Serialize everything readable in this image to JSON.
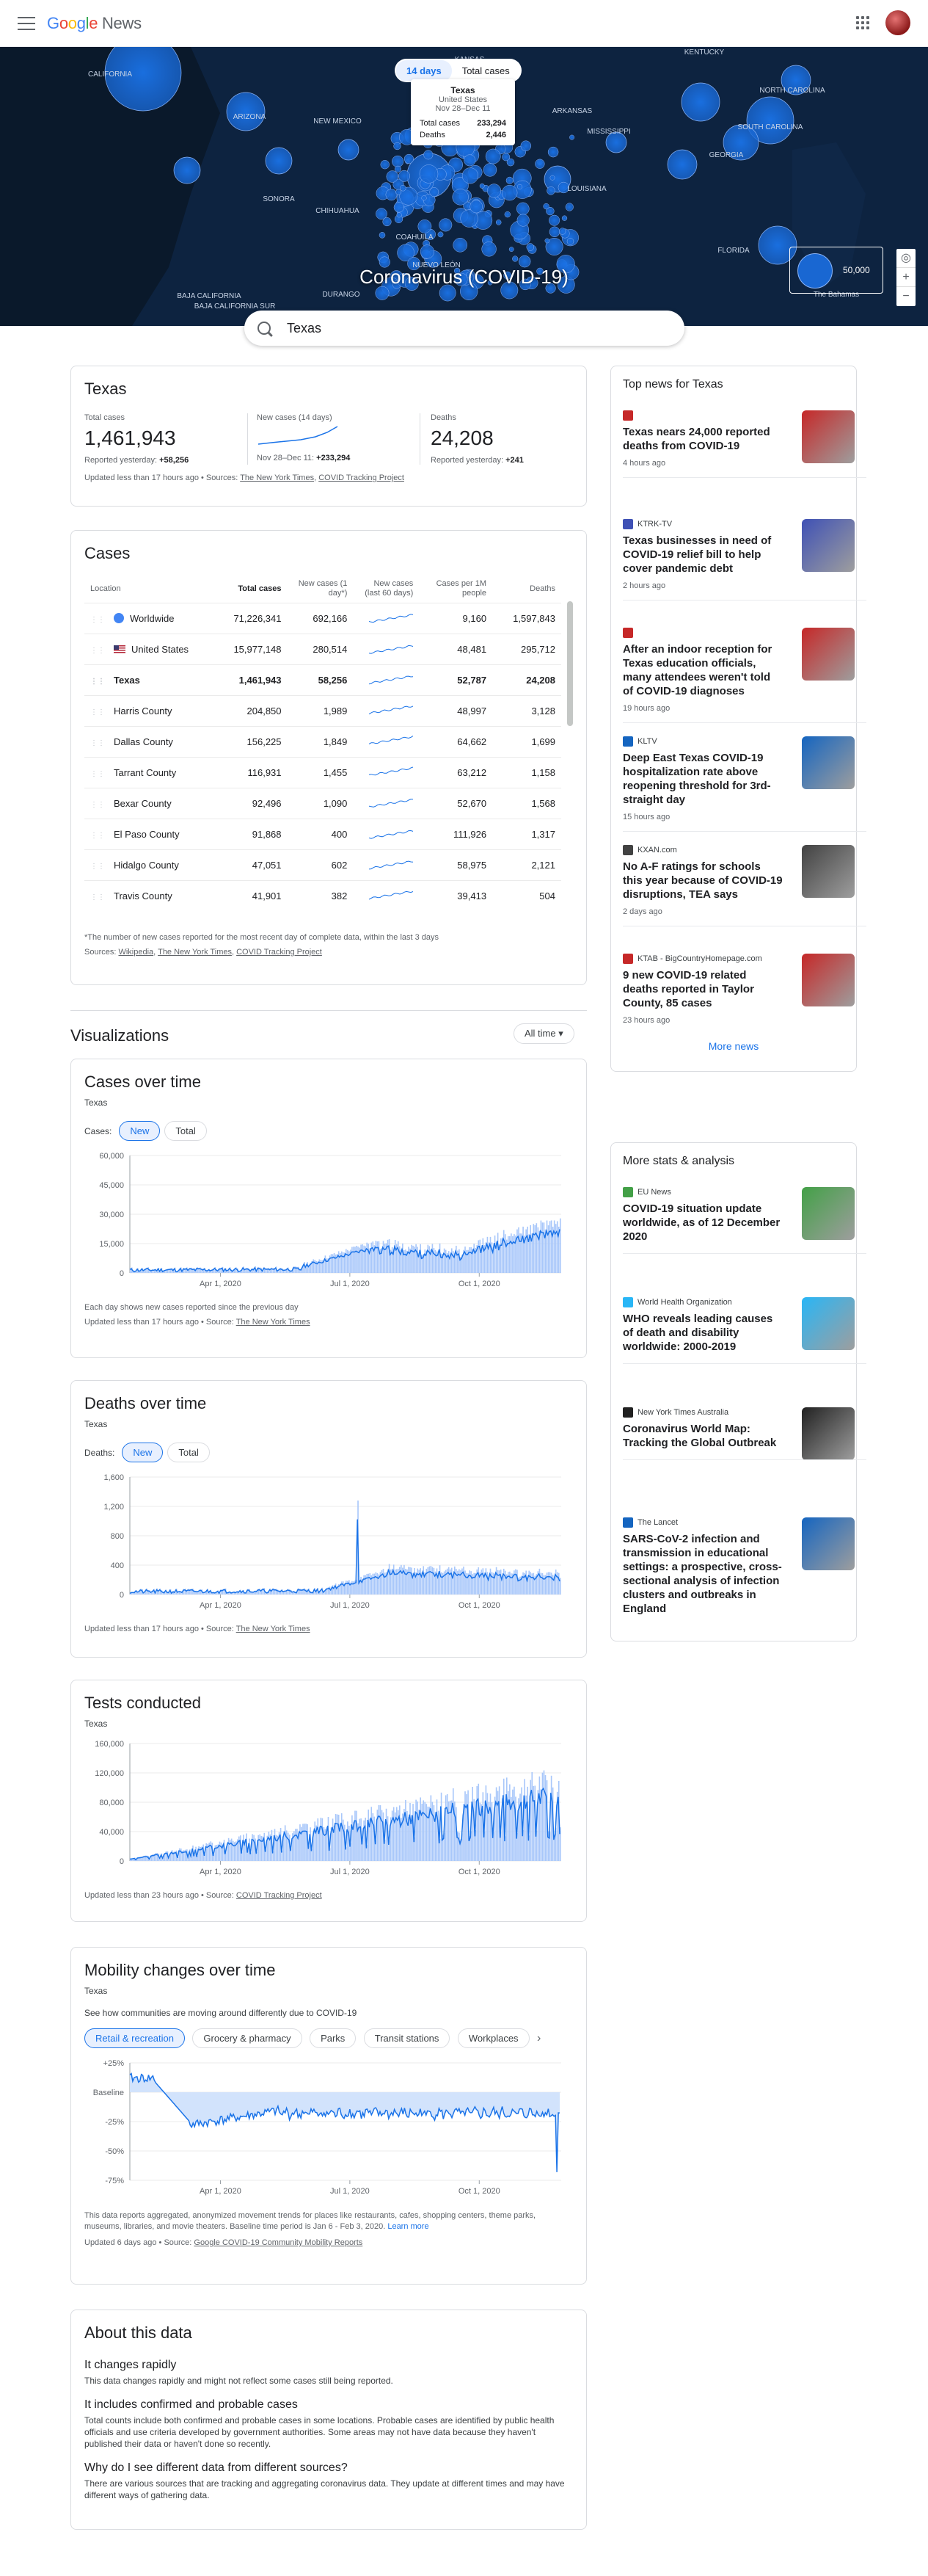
{
  "header": {
    "logo_google": "Google",
    "logo_news": "News"
  },
  "map": {
    "title": "Coronavirus (COVID-19)",
    "toggle": [
      "14 days",
      "Total cases"
    ],
    "tooltip": {
      "name": "Texas",
      "country": "United States",
      "range": "Nov 28–Dec 11",
      "cases_label": "Total cases",
      "cases": "233,294",
      "deaths_label": "Deaths",
      "deaths": "2,446"
    },
    "legend_value": "50,000",
    "labels": [
      "CALIFORNIA",
      "ARIZONA",
      "NEW MEXICO",
      "SONORA",
      "CHIHUAHUA",
      "BAJA CALIFORNIA",
      "COAHUILA",
      "KANSAS",
      "ARKANSAS",
      "MISSISSIPPI",
      "GEORGIA",
      "SOUTH CAROLINA",
      "NORTH CAROLINA",
      "LOUISIANA",
      "FLORIDA",
      "KENTUCKY",
      "NUEVO LEÓN",
      "BAJA CALIFORNIA SUR",
      "DURANGO",
      "The Bahamas"
    ],
    "colors": {
      "bg": "#0b1a2e",
      "bubble": "#1967d2"
    }
  },
  "search": {
    "value": "Texas"
  },
  "summary": {
    "title": "Texas",
    "total_label": "Total cases",
    "total": "1,461,943",
    "total_yesterday_label": "Reported yesterday:",
    "total_yesterday": "+58,256",
    "new_label": "New cases (14 days)",
    "new_range": "Nov 28–Dec 11:",
    "new_value": "+233,294",
    "deaths_label": "Deaths",
    "deaths": "24,208",
    "deaths_yesterday_label": "Reported yesterday:",
    "deaths_yesterday": "+241",
    "updated": "Updated less than 17 hours ago",
    "sources_label": "Sources:",
    "source_1": "The New York Times",
    "source_2": "COVID Tracking Project"
  },
  "cases_table": {
    "title": "Cases",
    "columns": [
      "Location",
      "Total cases",
      "New cases (1 day*)",
      "New cases (last 60 days)",
      "Cases per 1M people",
      "Deaths"
    ],
    "rows": [
      {
        "name": "Worldwide",
        "total": "71,226,341",
        "new": "692,166",
        "per1m": "9,160",
        "deaths": "1,597,843"
      },
      {
        "name": "United States",
        "total": "15,977,148",
        "new": "280,514",
        "per1m": "48,481",
        "deaths": "295,712"
      },
      {
        "name": "Texas",
        "total": "1,461,943",
        "new": "58,256",
        "per1m": "52,787",
        "deaths": "24,208"
      },
      {
        "name": "Harris County",
        "total": "204,850",
        "new": "1,989",
        "per1m": "48,997",
        "deaths": "3,128"
      },
      {
        "name": "Dallas County",
        "total": "156,225",
        "new": "1,849",
        "per1m": "64,662",
        "deaths": "1,699"
      },
      {
        "name": "Tarrant County",
        "total": "116,931",
        "new": "1,455",
        "per1m": "63,212",
        "deaths": "1,158"
      },
      {
        "name": "Bexar County",
        "total": "92,496",
        "new": "1,090",
        "per1m": "52,670",
        "deaths": "1,568"
      },
      {
        "name": "El Paso County",
        "total": "91,868",
        "new": "400",
        "per1m": "111,926",
        "deaths": "1,317"
      },
      {
        "name": "Hidalgo County",
        "total": "47,051",
        "new": "602",
        "per1m": "58,975",
        "deaths": "2,121"
      },
      {
        "name": "Travis County",
        "total": "41,901",
        "new": "382",
        "per1m": "39,413",
        "deaths": "504"
      }
    ],
    "footnote": "*The number of new cases reported for the most recent day of complete data, within the last 3 days",
    "sources_label": "Sources:",
    "source_1": "Wikipedia",
    "source_2": "The New York Times",
    "source_3": "COVID Tracking Project"
  },
  "visualizations": {
    "title": "Visualizations",
    "range": "All time"
  },
  "cases_chart": {
    "title": "Cases over time",
    "region": "Texas",
    "toggle_label": "Cases:",
    "toggle": [
      "New",
      "Total"
    ],
    "yticks": [
      "60,000",
      "45,000",
      "30,000",
      "15,000",
      "0"
    ],
    "xticks": [
      "Apr 1, 2020",
      "Jul 1, 2020",
      "Oct 1, 2020"
    ],
    "note": "Each day shows new cases reported since the previous day",
    "updated": "Updated less than 17 hours ago",
    "source_label": "Source:",
    "source": "The New York Times"
  },
  "deaths_chart": {
    "title": "Deaths over time",
    "region": "Texas",
    "toggle_label": "Deaths:",
    "toggle": [
      "New",
      "Total"
    ],
    "yticks": [
      "1,600",
      "1,200",
      "800",
      "400",
      "0"
    ],
    "xticks": [
      "Apr 1, 2020",
      "Jul 1, 2020",
      "Oct 1, 2020"
    ],
    "updated": "Updated less than 17 hours ago",
    "source_label": "Source:",
    "source": "The New York Times"
  },
  "tests_chart": {
    "title": "Tests conducted",
    "region": "Texas",
    "yticks": [
      "160,000",
      "120,000",
      "80,000",
      "40,000",
      "0"
    ],
    "xticks": [
      "Apr 1, 2020",
      "Jul 1, 2020",
      "Oct 1, 2020"
    ],
    "updated": "Updated less than 23 hours ago",
    "source_label": "Source:",
    "source": "COVID Tracking Project"
  },
  "mobility": {
    "title": "Mobility changes over time",
    "region": "Texas",
    "desc": "See how communities are moving around differently due to COVID-19",
    "chips": [
      "Retail & recreation",
      "Grocery & pharmacy",
      "Parks",
      "Transit stations",
      "Workplaces"
    ],
    "yticks": [
      "+25%",
      "Baseline",
      "-25%",
      "-50%",
      "-75%"
    ],
    "xticks": [
      "Apr 1, 2020",
      "Jul 1, 2020",
      "Oct 1, 2020"
    ],
    "note": "This data reports aggregated, anonymized movement trends for places like restaurants, cafes, shopping centers, theme parks, museums, libraries, and movie theaters. Baseline time period is Jan 6 - Feb 3, 2020.",
    "learn_more": "Learn more",
    "updated": "Updated 6 days ago",
    "source_label": "Source:",
    "source": "Google COVID-19 Community Mobility Reports"
  },
  "about": {
    "title": "About this data",
    "h1": "It changes rapidly",
    "p1": "This data changes rapidly and might not reflect some cases still being reported.",
    "h2": "It includes confirmed and probable cases",
    "p2": "Total counts include both confirmed and probable cases in some locations. Probable cases are identified by public health officials and use criteria developed by government authorities. Some areas may not have data because they haven't published their data or haven't done so recently.",
    "h3": "Why do I see different data from different sources?",
    "p3": "There are various sources that are tracking and aggregating coronavirus data. They update at different times and may have different ways of gathering data."
  },
  "top_news": {
    "title": "Top news for Texas",
    "items": [
      {
        "source": "",
        "title": "Texas nears 24,000 reported deaths from COVID-19",
        "time": "4 hours ago",
        "color": "#c62828"
      },
      {
        "source": "KTRK-TV",
        "title": "Texas businesses in need of COVID-19 relief bill to help cover pandemic debt",
        "time": "2 hours ago",
        "color": "#3f51b5"
      },
      {
        "source": "",
        "title": "After an indoor reception for Texas education officials, many attendees weren't told of COVID-19 diagnoses",
        "time": "19 hours ago",
        "color": "#c62828"
      },
      {
        "source": "KLTV",
        "title": "Deep East Texas COVID-19 hospitalization rate above reopening threshold for 3rd-straight day",
        "time": "15 hours ago",
        "color": "#1565c0"
      },
      {
        "source": "KXAN.com",
        "title": "No A-F ratings for schools this year because of COVID-19 disruptions, TEA says",
        "time": "2 days ago",
        "color": "#424242"
      },
      {
        "source": "KTAB - BigCountryHomepage.com",
        "title": "9 new COVID-19 related deaths reported in Taylor County, 85 cases",
        "time": "23 hours ago",
        "color": "#c62828"
      }
    ],
    "more": "More news"
  },
  "more_stats": {
    "title": "More stats & analysis",
    "items": [
      {
        "source": "EU News",
        "title": "COVID-19 situation update worldwide, as of 12 December 2020",
        "color": "#43a047"
      },
      {
        "source": "World Health Organization",
        "title": "WHO reveals leading causes of death and disability worldwide: 2000-2019",
        "color": "#29b6f6"
      },
      {
        "source": "New York Times Australia",
        "title": "Coronavirus World Map: Tracking the Global Outbreak",
        "color": "#212121"
      },
      {
        "source": "The Lancet",
        "title": "SARS-CoV-2 infection and transmission in educational settings: a prospective, cross-sectional analysis of infection clusters and outbreaks in England",
        "color": "#1565c0"
      }
    ]
  }
}
